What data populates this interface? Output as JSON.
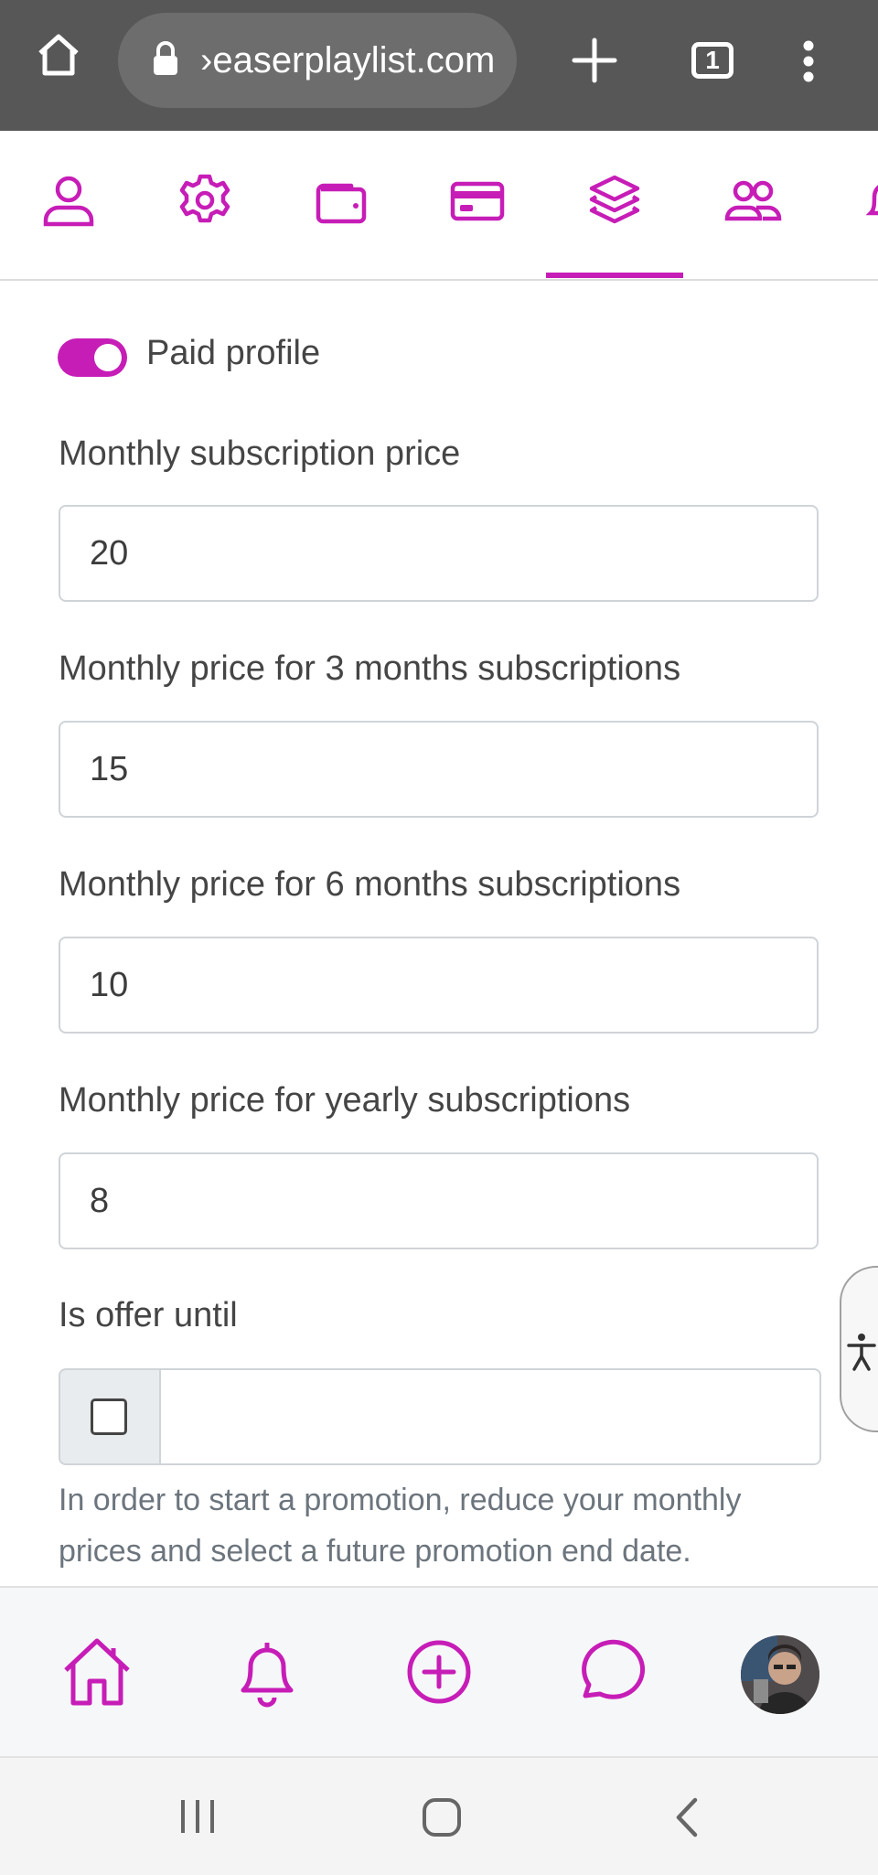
{
  "browser": {
    "url": "›easerplaylist.com",
    "tab_count": "1",
    "icons": [
      "home-icon",
      "lock-icon",
      "new-tab-icon",
      "tab-switcher-icon",
      "more-menu-icon"
    ]
  },
  "tabs": {
    "items": [
      {
        "name": "profile",
        "icon": "person-icon"
      },
      {
        "name": "settings",
        "icon": "gear-icon"
      },
      {
        "name": "wallet",
        "icon": "wallet-icon"
      },
      {
        "name": "payment",
        "icon": "credit-card-icon"
      },
      {
        "name": "subscriptions",
        "icon": "layers-icon",
        "active": true
      },
      {
        "name": "referrals",
        "icon": "users-icon"
      },
      {
        "name": "notifications",
        "icon": "bell-icon"
      }
    ],
    "accent": "#c71db7"
  },
  "form": {
    "paid_profile": {
      "label": "Paid profile",
      "enabled": true
    },
    "monthly": {
      "label": "Monthly subscription price",
      "value": "20"
    },
    "three_months": {
      "label": "Monthly price for 3 months subscriptions",
      "value": "15"
    },
    "six_months": {
      "label": "Monthly price for 6 months subscriptions",
      "value": "10"
    },
    "yearly": {
      "label": "Monthly price for yearly subscriptions",
      "value": "8"
    },
    "offer": {
      "label": "Is offer until",
      "checked": false,
      "date_value": "",
      "help": "In order to start a promotion, reduce your monthly prices and select a future promotion end date."
    }
  },
  "bottom_nav": {
    "items": [
      "home-icon",
      "bell-icon",
      "plus-circle-icon",
      "chat-icon",
      "avatar"
    ]
  },
  "system_nav": [
    "recents-button",
    "home-button",
    "back-button"
  ]
}
